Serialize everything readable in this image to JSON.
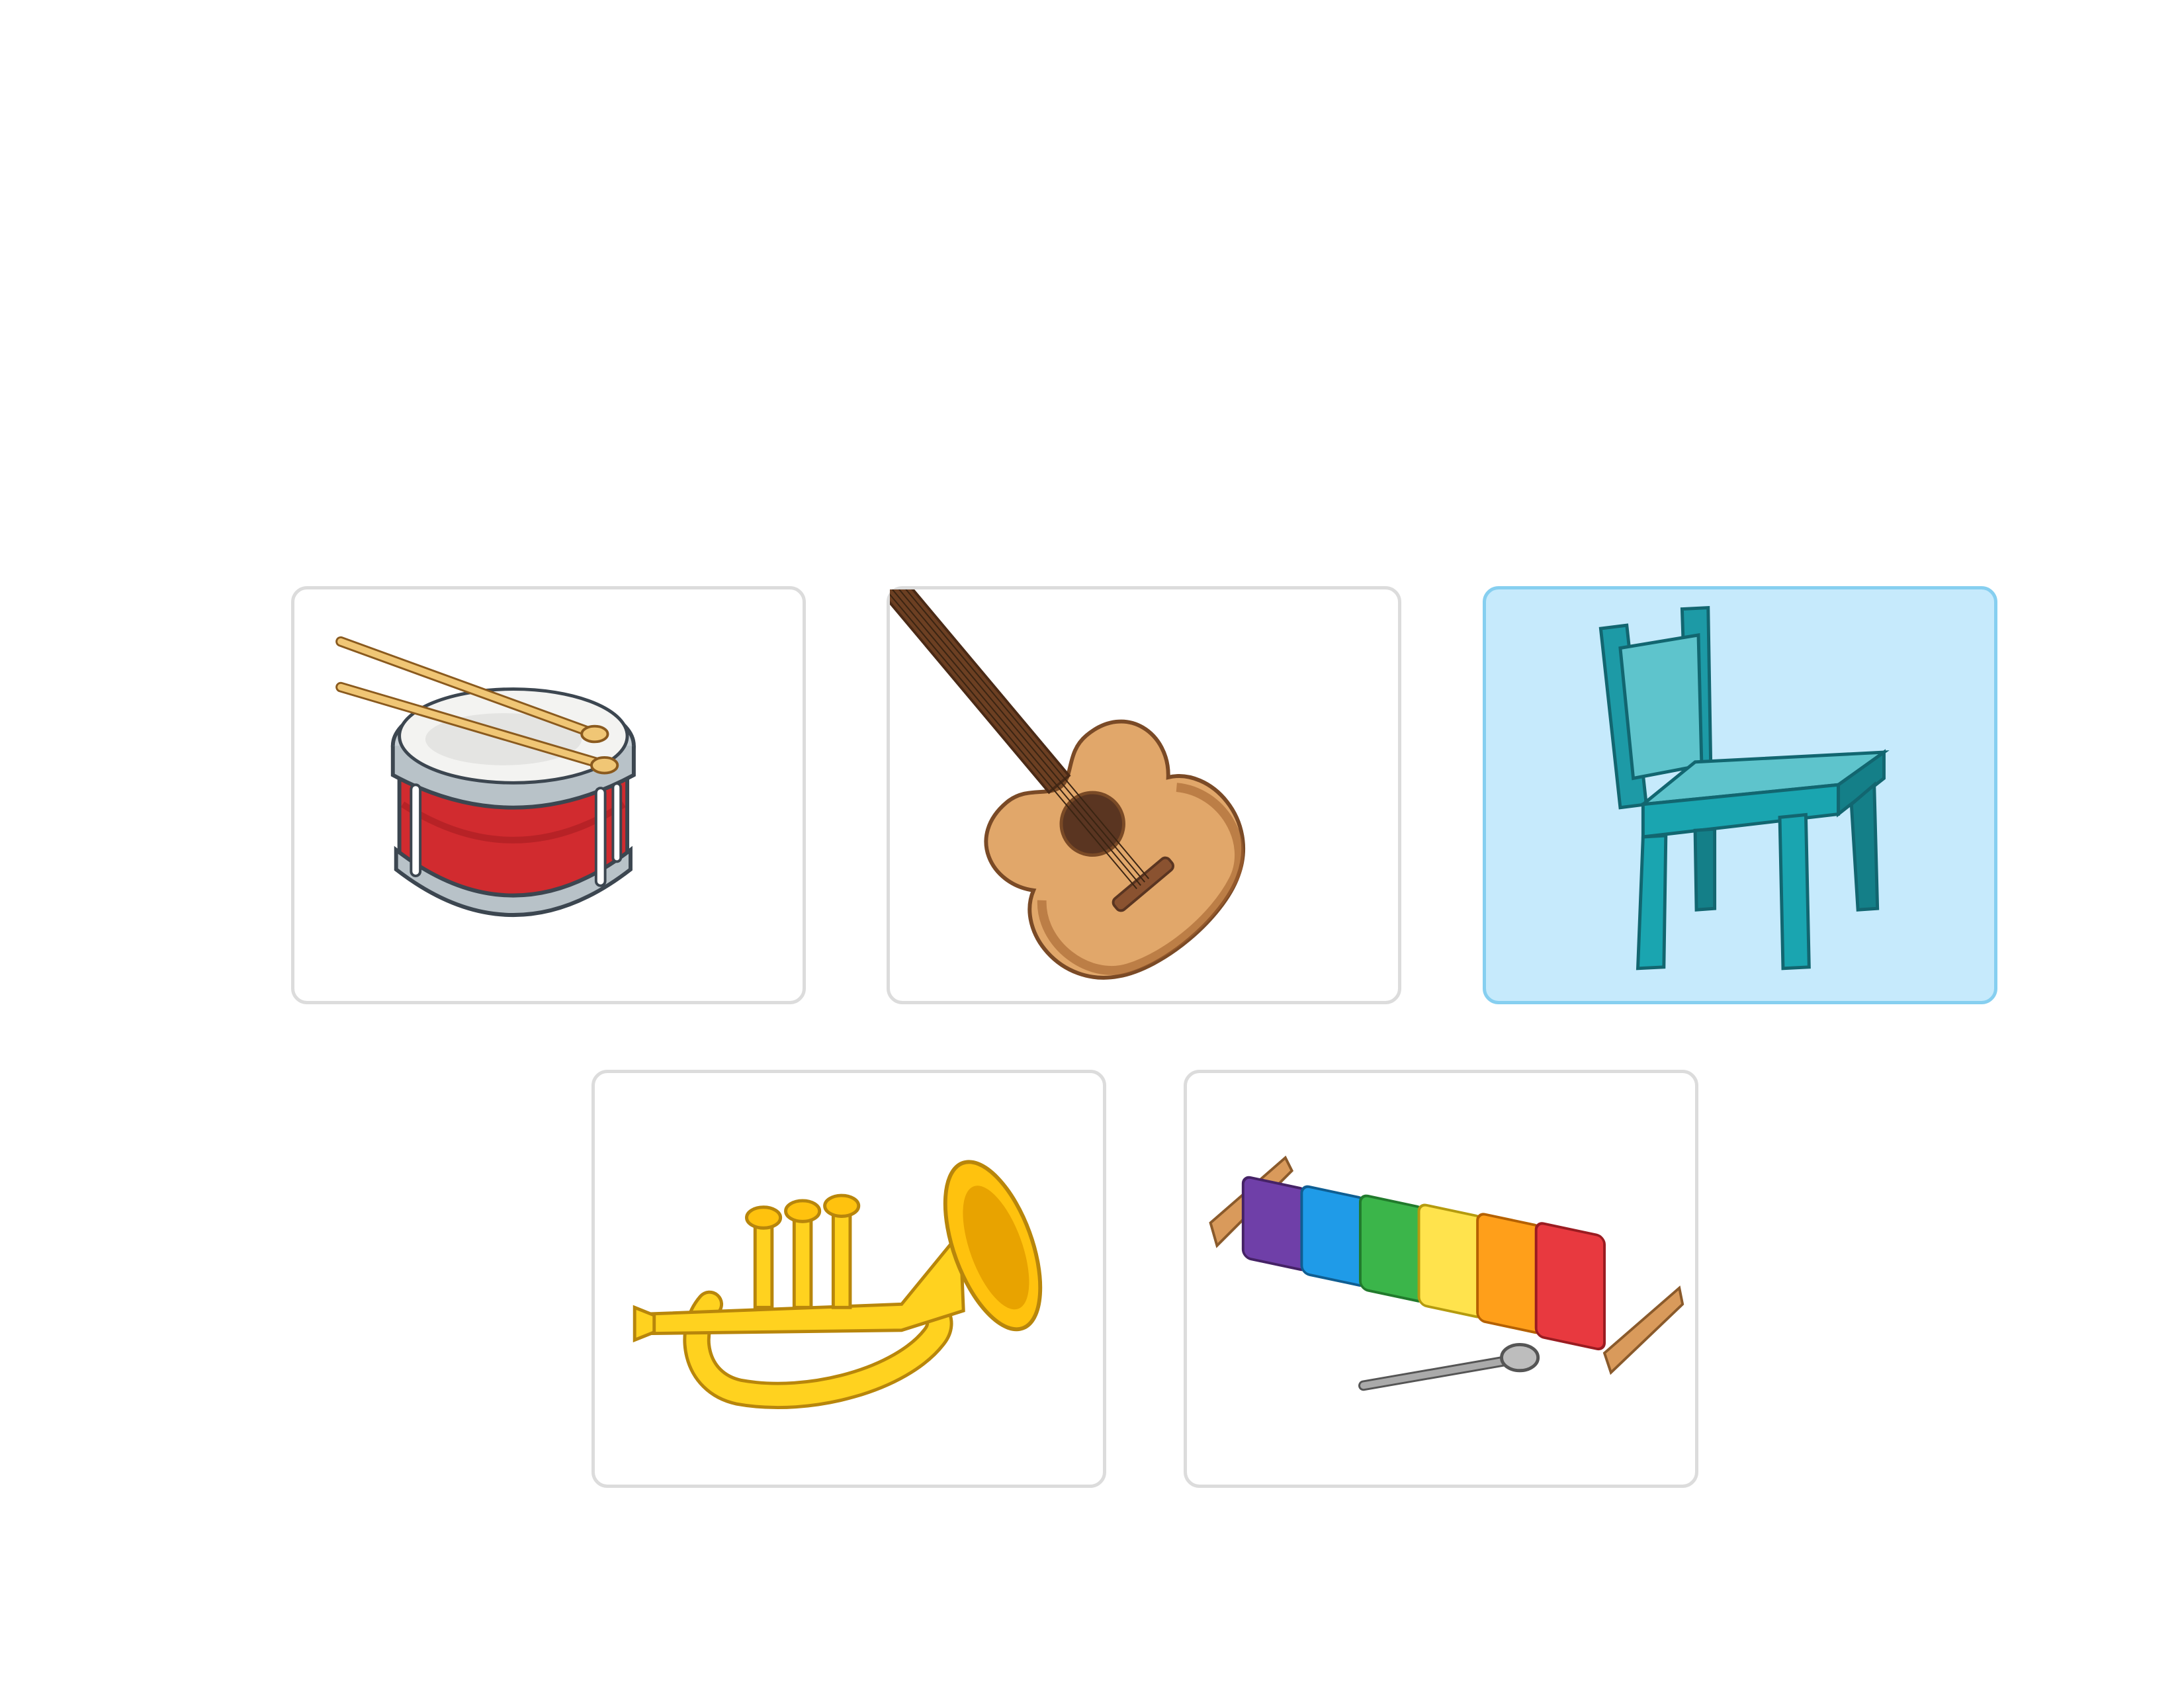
{
  "choices": [
    {
      "id": "drum",
      "icon": "drum-icon",
      "selected": false
    },
    {
      "id": "guitar",
      "icon": "guitar-icon",
      "selected": false
    },
    {
      "id": "chair",
      "icon": "chair-icon",
      "selected": true
    },
    {
      "id": "trumpet",
      "icon": "trumpet-icon",
      "selected": false
    },
    {
      "id": "xylophone",
      "icon": "xylophone-icon",
      "selected": false
    }
  ],
  "colors": {
    "card_border": "#dcdcdc",
    "selected_background": "#c6eafc",
    "selected_border": "#86cff0"
  }
}
